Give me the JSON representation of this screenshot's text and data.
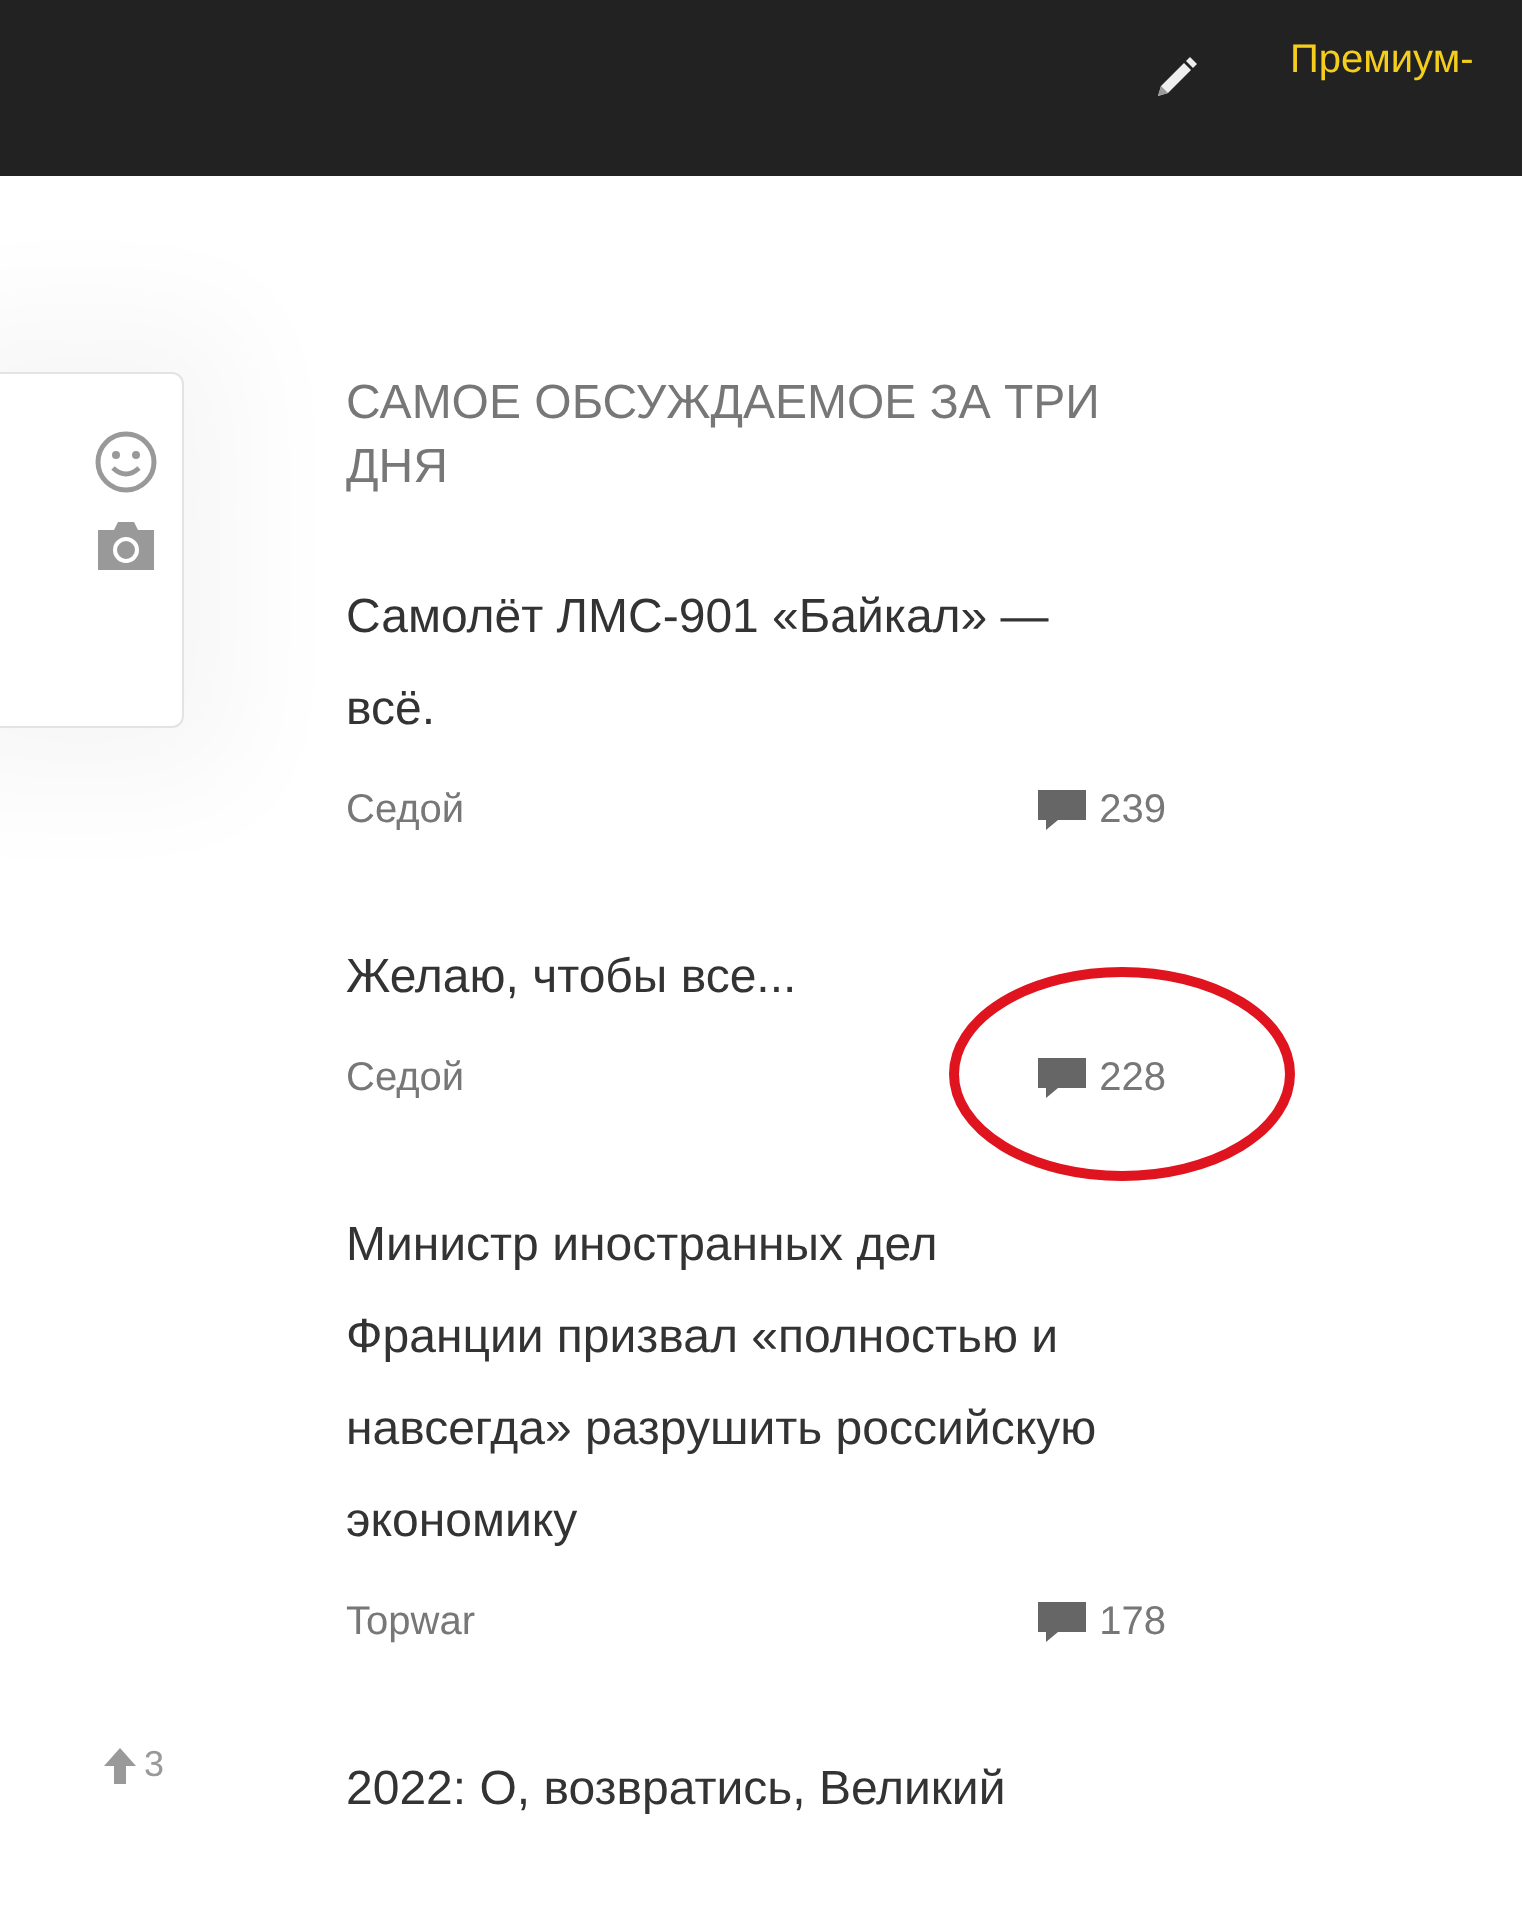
{
  "header": {
    "premium_link": "Премиум-"
  },
  "comment_box": {
    "vote_count": "3"
  },
  "discussed": {
    "title": "САМОЕ ОБСУЖДАЕМОЕ ЗА ТРИ ДНЯ",
    "items": [
      {
        "title": "Самолёт ЛМС-901 «Байкал» — всё.",
        "author": "Седой",
        "comments": "239",
        "circled": false
      },
      {
        "title": "Желаю, чтобы все...",
        "author": "Седой",
        "comments": "228",
        "circled": true
      },
      {
        "title": "Министр иностранных дел Франции призвал «полностью и навсегда» разрушить российскую экономику",
        "author": "Topwar",
        "comments": "178",
        "circled": false
      },
      {
        "title": "2022: О, возвратись, Великий"
      }
    ]
  }
}
